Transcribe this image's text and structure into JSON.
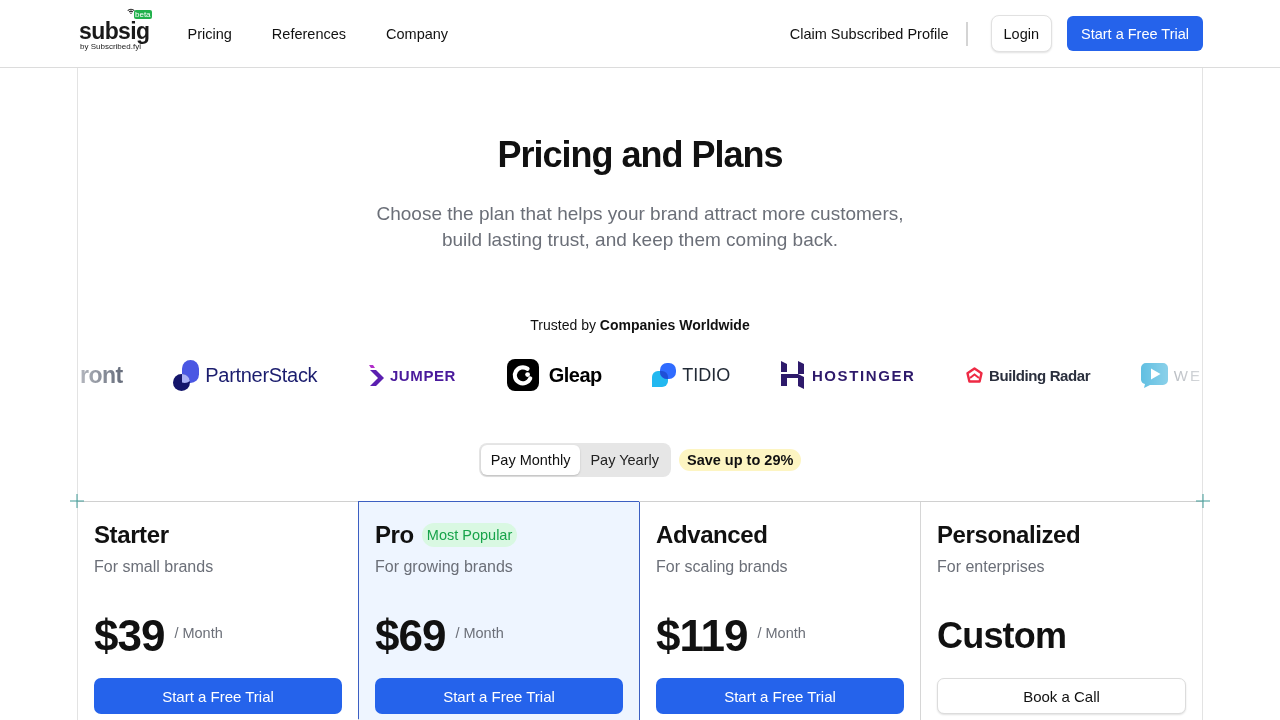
{
  "header": {
    "logo": {
      "wordmark": "subsig",
      "badge": "beta",
      "tagline": "by Subscribed.fyi"
    },
    "nav": [
      "Pricing",
      "References",
      "Company"
    ],
    "claim_link": "Claim Subscribed Profile",
    "login_button": "Login",
    "trial_button": "Start a Free Trial"
  },
  "hero": {
    "title": "Pricing and Plans",
    "subtitle": "Choose the plan that helps your brand attract more customers, build lasting trust, and keep them coming back."
  },
  "trusted": {
    "text": "Trusted by **Companies Worldwide**",
    "logos": [
      {
        "kind": "wordmark",
        "text": "ront"
      },
      {
        "kind": "circles",
        "text": "PartnerStack"
      },
      {
        "kind": "chevron",
        "text": "JUMPER"
      },
      {
        "kind": "ring",
        "text": "Gleap"
      },
      {
        "kind": "bubbles",
        "text": "TIDIO"
      },
      {
        "kind": "h-mark",
        "text": "HOSTINGER"
      },
      {
        "kind": "house",
        "text": "Building Radar"
      },
      {
        "kind": "play-bubble",
        "text": "WE"
      }
    ]
  },
  "billing": {
    "options": [
      {
        "label": "Pay Monthly",
        "selected": true
      },
      {
        "label": "Pay Yearly",
        "selected": false
      }
    ],
    "badge": "Save up to 29%"
  },
  "plans": [
    {
      "name": "Starter",
      "tagline": "For small brands",
      "price": "$39",
      "period": "/ Month",
      "featured": false,
      "button": {
        "kind": "primary",
        "label": "Start a Free Trial"
      }
    },
    {
      "name": "Pro",
      "badge": "Most Popular",
      "tagline": "For growing brands",
      "price": "$69",
      "period": "/ Month",
      "featured": true,
      "button": {
        "kind": "primary",
        "label": "Start a Free Trial"
      }
    },
    {
      "name": "Advanced",
      "tagline": "For scaling brands",
      "price": "$119",
      "period": "/ Month",
      "featured": false,
      "button": {
        "kind": "primary",
        "label": "Start a Free Trial"
      }
    },
    {
      "name": "Personalized",
      "tagline": "For enterprises",
      "price": "Custom",
      "featured": false,
      "button": {
        "kind": "secondary",
        "label": "Book a Call"
      }
    }
  ]
}
